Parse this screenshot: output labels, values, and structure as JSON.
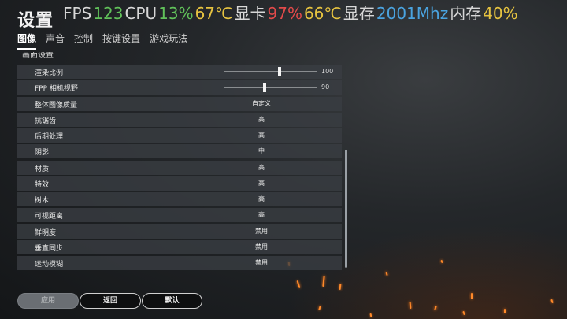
{
  "page": {
    "title": "设置"
  },
  "osd": {
    "parts": [
      {
        "text": "FPS",
        "color": "#d8d8d8"
      },
      {
        "text": "123",
        "color": "#61c25a"
      },
      {
        "text": "CPU",
        "color": "#d8d8d8"
      },
      {
        "text": "13%",
        "color": "#61c25a"
      },
      {
        "text": "67℃",
        "color": "#e6c340"
      },
      {
        "text": "显卡",
        "color": "#d8d8d8"
      },
      {
        "text": "97%",
        "color": "#e24a4a"
      },
      {
        "text": "66℃",
        "color": "#e6c340"
      },
      {
        "text": "显存",
        "color": "#d8d8d8"
      },
      {
        "text": "2001Mhz",
        "color": "#4aa3e0"
      },
      {
        "text": "内存",
        "color": "#d8d8d8"
      },
      {
        "text": "40%",
        "color": "#e6c340"
      }
    ]
  },
  "tabs": [
    {
      "label": "图像",
      "active": true
    },
    {
      "label": "声音",
      "active": false
    },
    {
      "label": "控制",
      "active": false
    },
    {
      "label": "按键设置",
      "active": false
    },
    {
      "label": "游戏玩法",
      "active": false
    }
  ],
  "section_peek": "画面设置",
  "rows": [
    {
      "label": "渲染比例",
      "type": "slider",
      "value": "100",
      "slider_fraction": 0.6
    },
    {
      "label": "FPP 相机视野",
      "type": "slider",
      "value": "90",
      "slider_fraction": 0.44
    },
    {
      "label": "整体图像质量",
      "type": "text",
      "value": "自定义"
    },
    {
      "label": "抗锯齿",
      "type": "text",
      "value": "高"
    },
    {
      "label": "后期处理",
      "type": "text",
      "value": "高"
    },
    {
      "label": "阴影",
      "type": "text",
      "value": "中"
    },
    {
      "label": "材质",
      "type": "text",
      "value": "高"
    },
    {
      "label": "特效",
      "type": "text",
      "value": "高"
    },
    {
      "label": "树木",
      "type": "text",
      "value": "高"
    },
    {
      "label": "可视距离",
      "type": "text",
      "value": "高"
    },
    {
      "label": "鲜明度",
      "type": "text",
      "value": "禁用"
    },
    {
      "label": "垂直同步",
      "type": "text",
      "value": "禁用"
    },
    {
      "label": "运动模糊",
      "type": "text",
      "value": "禁用"
    }
  ],
  "buttons": {
    "apply": "应用",
    "back": "返回",
    "default": "默认"
  }
}
